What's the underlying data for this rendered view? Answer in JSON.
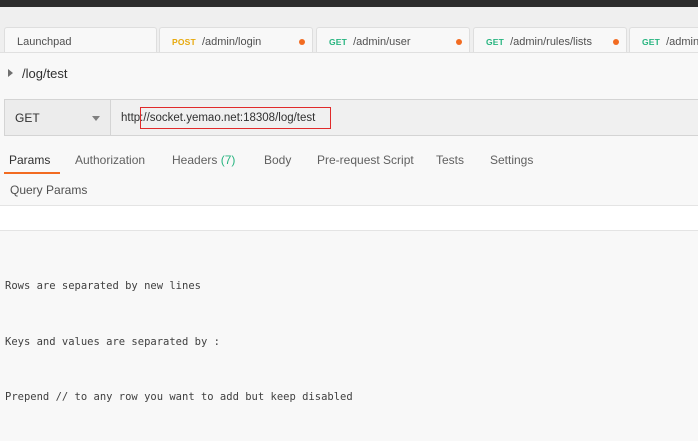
{
  "tabs": [
    {
      "method": "",
      "path": "Launchpad",
      "method_color": "",
      "unsaved": false
    },
    {
      "method": "POST",
      "path": "/admin/login",
      "method_color": "#e7a90c",
      "unsaved": true
    },
    {
      "method": "GET",
      "path": "/admin/user",
      "method_color": "#26b47f",
      "unsaved": true
    },
    {
      "method": "GET",
      "path": "/admin/rules/lists",
      "method_color": "#26b47f",
      "unsaved": true
    },
    {
      "method": "GET",
      "path": "/admin/r",
      "method_color": "#26b47f",
      "unsaved": false
    }
  ],
  "request": {
    "title": "/log/test",
    "method": "GET",
    "url": "http://socket.yemao.net:18308/log/test"
  },
  "request_tabs": {
    "params": "Params",
    "authorization": "Authorization",
    "headers": "Headers",
    "headers_count": "(7)",
    "body": "Body",
    "pre_request": "Pre-request Script",
    "tests": "Tests",
    "settings": "Settings"
  },
  "query_params_title": "Query Params",
  "help_lines": [
    "Rows are separated by new lines",
    "Keys and values are separated by :",
    "Prepend // to any row you want to add but keep disabled"
  ],
  "colors": {
    "accent": "#f26b21",
    "get": "#26b47f",
    "post": "#e7a90c",
    "highlight": "#e02a2a"
  }
}
